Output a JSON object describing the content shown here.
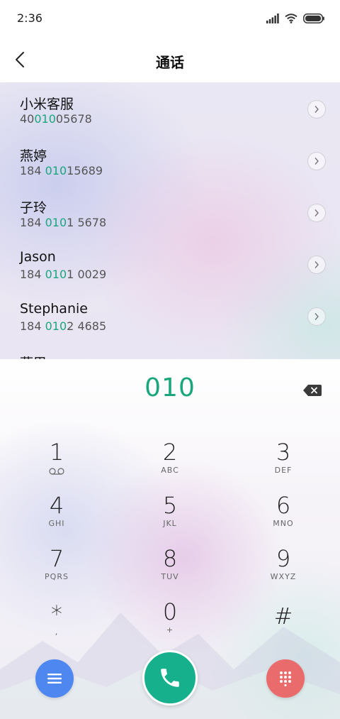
{
  "status_bar": {
    "time": "2:36"
  },
  "header": {
    "title": "通话"
  },
  "contacts": [
    {
      "name": "小米客服",
      "number_prefix": "40",
      "number_match": "010",
      "number_suffix": "05678"
    },
    {
      "name": "燕婷",
      "number_prefix": "184 ",
      "number_match": "010",
      "number_suffix": "15689"
    },
    {
      "name": "子玲",
      "number_prefix": "184 ",
      "number_match": "010",
      "number_suffix": "1 5678"
    },
    {
      "name": "Jason",
      "number_prefix": "184 ",
      "number_match": "010",
      "number_suffix": "1 0029"
    },
    {
      "name": "Stephanie",
      "number_prefix": "184 ",
      "number_match": "010",
      "number_suffix": "2 4685"
    }
  ],
  "partial_contact": {
    "name": "燕巴"
  },
  "dialer": {
    "entered_number": "010",
    "keys": [
      {
        "digit": "1",
        "sub": ""
      },
      {
        "digit": "2",
        "sub": "ABC"
      },
      {
        "digit": "3",
        "sub": "DEF"
      },
      {
        "digit": "4",
        "sub": "GHI"
      },
      {
        "digit": "5",
        "sub": "JKL"
      },
      {
        "digit": "6",
        "sub": "MNO"
      },
      {
        "digit": "7",
        "sub": "PQRS"
      },
      {
        "digit": "8",
        "sub": "TUV"
      },
      {
        "digit": "9",
        "sub": "WXYZ"
      },
      {
        "digit": "*",
        "sub": ","
      },
      {
        "digit": "0",
        "sub": "+"
      },
      {
        "digit": "#",
        "sub": ""
      }
    ]
  },
  "icons": {
    "back": "chevron-left-icon",
    "detail": "chevron-right-icon",
    "delete": "backspace-icon",
    "voicemail": "voicemail-icon",
    "menu": "menu-icon",
    "call": "phone-icon",
    "keypad": "dialpad-icon"
  },
  "colors": {
    "match_highlight": "#1aa67c",
    "call_button": "#17b08d",
    "menu_button": "#4f87f0",
    "keypad_button": "#ea6b6b"
  }
}
